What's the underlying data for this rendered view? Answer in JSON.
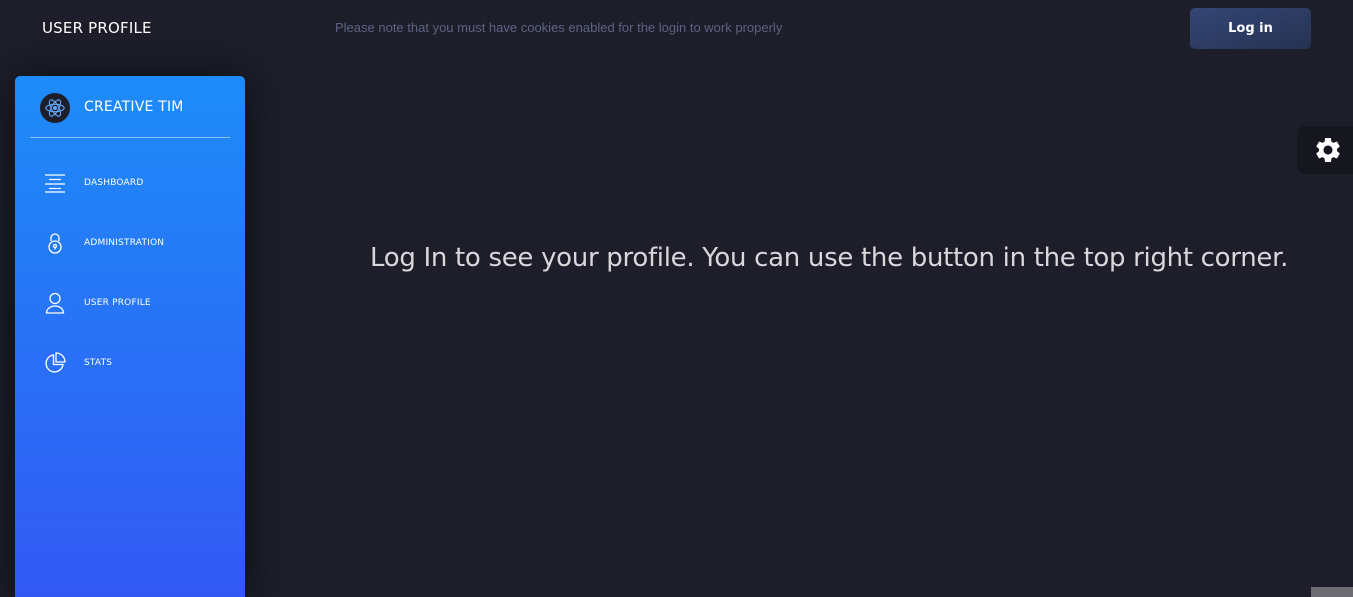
{
  "navbar": {
    "title": "USER PROFILE",
    "cookie_note": "Please note that you must have cookies enabled for the login to work properly",
    "login_label": "Log in"
  },
  "sidebar": {
    "brand": "CREATIVE TIM",
    "logo_icon": "react-atom-icon",
    "items": [
      {
        "label": "DASHBOARD",
        "icon": "align-center-icon"
      },
      {
        "label": "ADMINISTRATION",
        "icon": "lock-icon"
      },
      {
        "label": "USER PROFILE",
        "icon": "user-icon"
      },
      {
        "label": "STATS",
        "icon": "pie-chart-icon"
      }
    ]
  },
  "settings": {
    "icon": "gear-icon"
  },
  "main": {
    "message": "Log In to see your profile. You can use the button in the top right corner."
  },
  "colors": {
    "background": "#1e1e2b",
    "sidebar_top": "#1d8cf8",
    "sidebar_bottom": "#3358f4",
    "login_button": "#344675",
    "muted_text": "#5b6282"
  }
}
